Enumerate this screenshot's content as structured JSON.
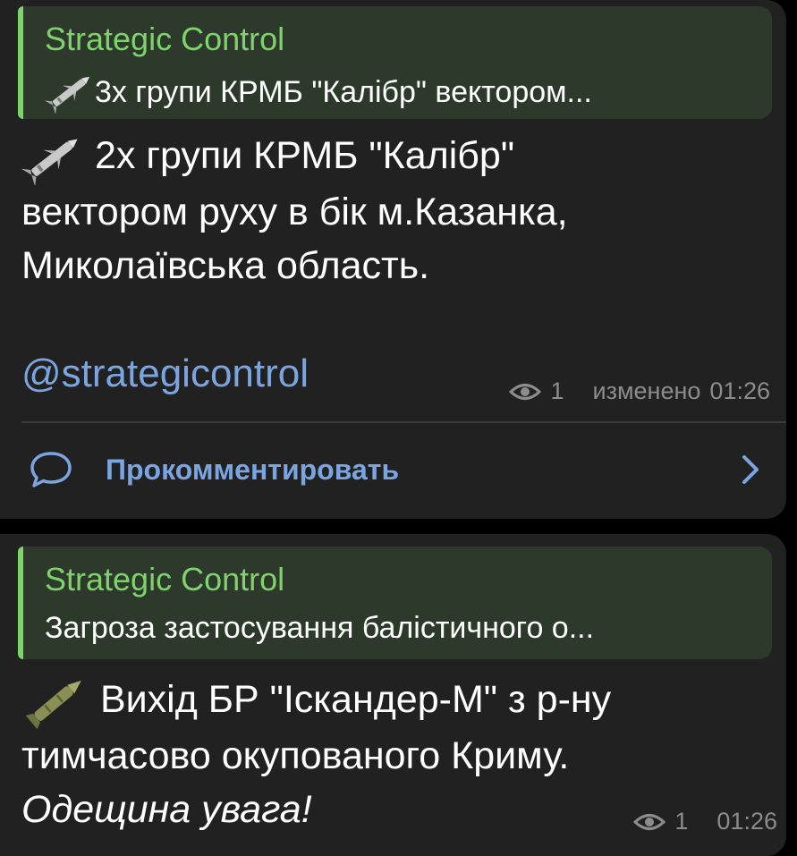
{
  "colors": {
    "background": "#000000",
    "bubble": "#212121",
    "reply_background": "#2d3a2b",
    "reply_accent": "#7ed36b",
    "link": "#7ba5e0",
    "meta": "#8c8c8c",
    "text": "#ffffff"
  },
  "messages": [
    {
      "reply": {
        "author": "Strategic Control",
        "icon": "missile-icon",
        "text": "3х групи КРМБ \"Калібр\" вектором..."
      },
      "body": {
        "icon": "missile-icon",
        "lines": [
          "2х групи КРМБ \"Калібр\"",
          "вектором руху в бік м.Казанка,",
          "Миколаївська область."
        ]
      },
      "mention": "@strategicontrol",
      "meta": {
        "icon": "eye-icon",
        "views": "1",
        "edited": "изменено",
        "time": "01:26"
      },
      "comment": {
        "icon": "comment-bubble-icon",
        "label": "Прокомментировать",
        "chevron": "chevron-right-icon"
      }
    },
    {
      "reply": {
        "author": "Strategic Control",
        "text": "Загроза застосування балістичного о..."
      },
      "body": {
        "icon": "ballistic-missile-icon",
        "lines": [
          "Вихід БР \"Іскандер-М\" з р-ну",
          "тимчасово окупованого Криму.",
          "Одещина увага!"
        ]
      },
      "meta": {
        "icon": "eye-icon",
        "views": "1",
        "time": "01:26"
      }
    }
  ]
}
